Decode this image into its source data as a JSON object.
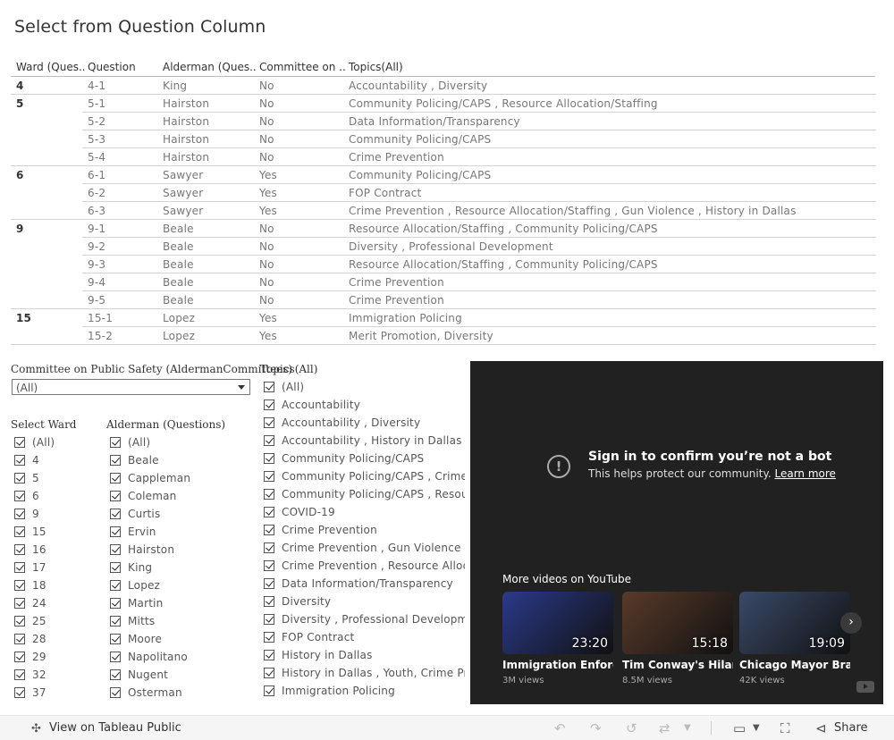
{
  "title": "Select from Question Column",
  "table": {
    "headers": [
      "Ward (Ques..",
      "Question",
      "Alderman (Ques..",
      "Committee on ..",
      "Topics(All)"
    ],
    "rows": [
      {
        "ward": "4",
        "question": "4-1",
        "alderman": "King",
        "committee": "No",
        "topics": "Accountability , Diversity"
      },
      {
        "ward": "5",
        "question": "5-1",
        "alderman": "Hairston",
        "committee": "No",
        "topics": "Community Policing/CAPS , Resource Allocation/Staffing"
      },
      {
        "ward": "",
        "question": "5-2",
        "alderman": "Hairston",
        "committee": "No",
        "topics": "Data Information/Transparency"
      },
      {
        "ward": "",
        "question": "5-3",
        "alderman": "Hairston",
        "committee": "No",
        "topics": "Community Policing/CAPS"
      },
      {
        "ward": "",
        "question": "5-4",
        "alderman": "Hairston",
        "committee": "No",
        "topics": "Crime Prevention"
      },
      {
        "ward": "6",
        "question": "6-1",
        "alderman": "Sawyer",
        "committee": "Yes",
        "topics": "Community Policing/CAPS"
      },
      {
        "ward": "",
        "question": "6-2",
        "alderman": "Sawyer",
        "committee": "Yes",
        "topics": "FOP Contract"
      },
      {
        "ward": "",
        "question": "6-3",
        "alderman": "Sawyer",
        "committee": "Yes",
        "topics": "Crime Prevention , Resource Allocation/Staffing , Gun Violence , History in Dallas"
      },
      {
        "ward": "9",
        "question": "9-1",
        "alderman": "Beale",
        "committee": "No",
        "topics": "Resource Allocation/Staffing , Community Policing/CAPS"
      },
      {
        "ward": "",
        "question": "9-2",
        "alderman": "Beale",
        "committee": "No",
        "topics": "Diversity , Professional Development"
      },
      {
        "ward": "",
        "question": "9-3",
        "alderman": "Beale",
        "committee": "No",
        "topics": "Resource Allocation/Staffing , Community Policing/CAPS"
      },
      {
        "ward": "",
        "question": "9-4",
        "alderman": "Beale",
        "committee": "No",
        "topics": "Crime Prevention"
      },
      {
        "ward": "",
        "question": "9-5",
        "alderman": "Beale",
        "committee": "No",
        "topics": "Crime Prevention"
      },
      {
        "ward": "15",
        "question": "15-1",
        "alderman": "Lopez",
        "committee": "Yes",
        "topics": "Immigration Policing"
      },
      {
        "ward": "",
        "question": "15-2",
        "alderman": "Lopez",
        "committee": "Yes",
        "topics": "Merit Promotion, Diversity"
      }
    ]
  },
  "filters": {
    "committee_label": "Committee on Public Safety (AldermanCommittees)",
    "committee_value": "(All)",
    "ward_label": "Select Ward",
    "wards": [
      "(All)",
      "4",
      "5",
      "6",
      "9",
      "15",
      "16",
      "17",
      "18",
      "24",
      "25",
      "28",
      "29",
      "32",
      "37"
    ],
    "alderman_label": "Alderman (Questions)",
    "aldermen": [
      "(All)",
      "Beale",
      "Cappleman",
      "Coleman",
      "Curtis",
      "Ervin",
      "Hairston",
      "King",
      "Lopez",
      "Martin",
      "Mitts",
      "Moore",
      "Napolitano",
      "Nugent",
      "Osterman"
    ],
    "topics_label": "Topics(All)",
    "topics": [
      "(All)",
      "Accountability",
      "Accountability , Diversity",
      "Accountability , History in Dallas",
      "Community Policing/CAPS",
      "Community Policing/CAPS , Crime ...",
      "Community Policing/CAPS , Resou...",
      "COVID-19",
      "Crime Prevention",
      "Crime Prevention , Gun Violence",
      "Crime Prevention , Resource Alloc...",
      "Data Information/Transparency",
      "Diversity",
      "Diversity , Professional Developm...",
      "FOP Contract",
      "History in Dallas",
      "History in Dallas , Youth, Crime Pr...",
      "Immigration Policing"
    ]
  },
  "video": {
    "heading": "Sign in to confirm you’re not a bot",
    "subtext": "This helps protect our community.",
    "learn_more": "Learn more",
    "more_label": "More videos on YouTube",
    "items": [
      {
        "title": "Immigration Enforce...",
        "views": "3M views",
        "duration": "23:20",
        "color": "#2a3a8a"
      },
      {
        "title": "Tim Conway's Hilario...",
        "views": "8.5M views",
        "duration": "15:18",
        "color": "#5a3a2a"
      },
      {
        "title": "Chicago Mayor Brand...",
        "views": "42K views",
        "duration": "19:09",
        "color": "#3a4a6a"
      }
    ]
  },
  "footer": {
    "tableau_label": "View on Tableau Public",
    "share_label": "Share"
  }
}
